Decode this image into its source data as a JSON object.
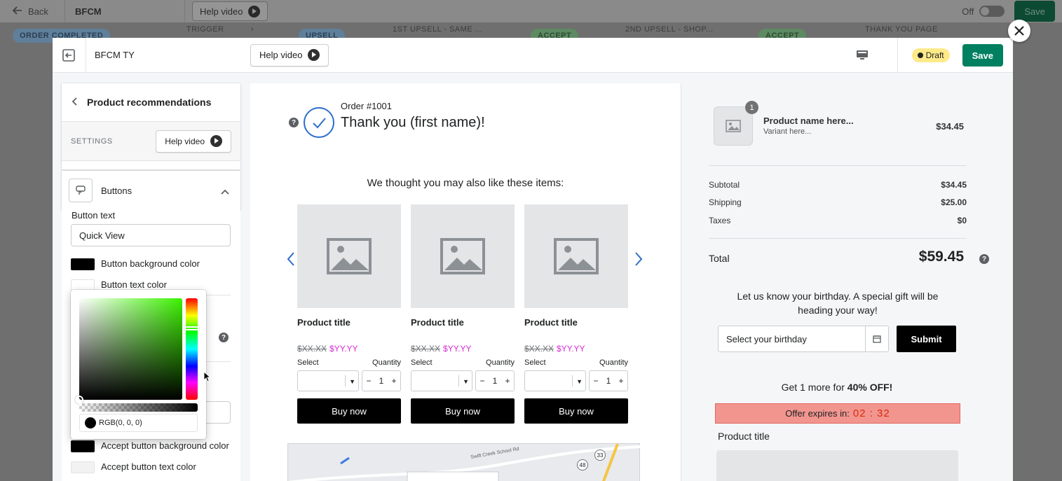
{
  "background": {
    "back_label": "Back",
    "app_title": "BFCM",
    "help_label": "Help video",
    "toggle_label": "Off",
    "save_label": "Save",
    "flow": {
      "order_completed": "ORDER COMPLETED",
      "trigger": "TRIGGER",
      "upsell": "UPSELL",
      "step1": "1ST UPSELL - SAME ...",
      "accept1": "ACCEPT",
      "step2": "2ND UPSELL - SHOP...",
      "accept2": "ACCEPT",
      "thank_you": "THANK YOU PAGE"
    }
  },
  "modal": {
    "title": "BFCM TY",
    "help_label": "Help video",
    "status": "Draft",
    "save_label": "Save"
  },
  "panel": {
    "title": "Product recommendations",
    "settings_label": "SETTINGS",
    "help_label": "Help video",
    "section_label": "Buttons",
    "button_text_label": "Button text",
    "button_text_value": "Quick View",
    "bg_color_label": "Button background color",
    "text_color_label": "Button text color",
    "accept_bg_label": "Accept button background color",
    "accept_text_label": "Accept button text color",
    "picker_value": "RGB(0, 0, 0)",
    "colors": {
      "button_bg": "#000000",
      "button_text": "#ffffff",
      "accept_bg": "#000000",
      "accept_text": "#f2f2f2"
    }
  },
  "preview": {
    "order_number": "Order #1001",
    "thank_you": "Thank you (first name)!",
    "also_like": "We thought you may also like these items:",
    "products": [
      {
        "title": "Product title",
        "old_price": "$XX.XX",
        "new_price": "$YY.YY",
        "select_label": "Select",
        "quantity_label": "Quantity",
        "quantity": "1",
        "buy_label": "Buy now"
      },
      {
        "title": "Product title",
        "old_price": "$XX.XX",
        "new_price": "$YY.YY",
        "select_label": "Select",
        "quantity_label": "Quantity",
        "quantity": "1",
        "buy_label": "Buy now"
      },
      {
        "title": "Product title",
        "old_price": "$XX.XX",
        "new_price": "$YY.YY",
        "select_label": "Select",
        "quantity_label": "Quantity",
        "quantity": "1",
        "buy_label": "Buy now"
      }
    ],
    "map_road": "Swift Creek School Rd",
    "map_route": "33",
    "map_route_2": "48"
  },
  "summary": {
    "item_count": "1",
    "product_name": "Product name here...",
    "variant": "Variant here...",
    "product_price": "$34.45",
    "subtotal_label": "Subtotal",
    "subtotal": "$34.45",
    "shipping_label": "Shipping",
    "shipping": "$25.00",
    "taxes_label": "Taxes",
    "taxes": "$0",
    "total_label": "Total",
    "total": "$59.45",
    "birthday_text": "Let us know your birthday. A special gift will be heading your way!",
    "birthday_placeholder": "Select your birthday",
    "submit_label": "Submit",
    "offer_prefix": "Get 1 more for ",
    "offer_bold": "40% OFF!",
    "expires_label": "Offer expires in:",
    "timer": "02 : 32",
    "upsell_title": "Product title"
  }
}
